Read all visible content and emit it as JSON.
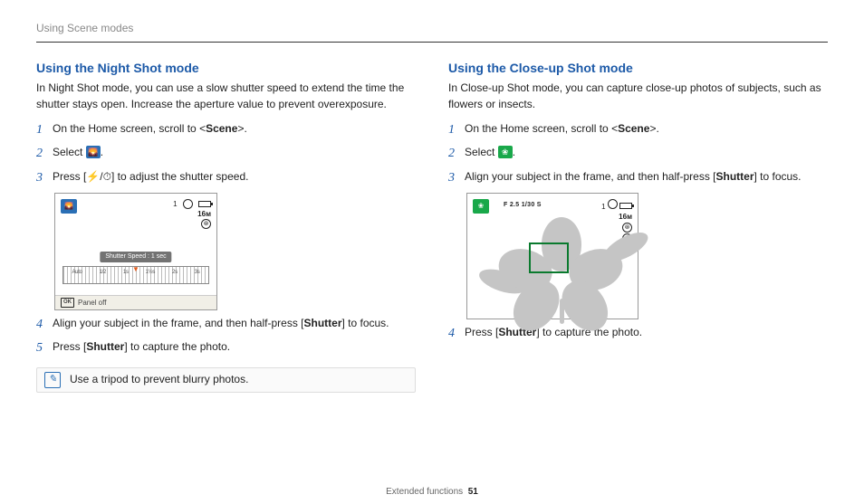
{
  "header": {
    "breadcrumb": "Using Scene modes"
  },
  "left": {
    "title": "Using the Night Shot mode",
    "intro": "In Night Shot mode, you can use a slow shutter speed to extend the time the shutter stays open. Increase the aperture value to prevent overexposure.",
    "step1_pre": "On the Home screen, scroll to <",
    "step1_bold": "Scene",
    "step1_post": ">.",
    "step2_pre": "Select ",
    "step2_post": ".",
    "step3_pre": "Press [",
    "step3_icon1": "⚡",
    "step3_sep": "/",
    "step3_icon2": "⏱",
    "step3_post": "] to adjust the shutter speed.",
    "lcd": {
      "mode_icon": "🌄",
      "count": "1",
      "res": "16ᴍ",
      "flash": "⊛",
      "ss_label": "Shutter Speed : 1 sec",
      "ticks": [
        "Auto",
        "1/2",
        "1s",
        "1½s",
        "2s",
        "3s"
      ],
      "ok": "OK",
      "panel_off": "Panel off"
    },
    "step4_pre": "Align your subject in the frame, and then half-press [",
    "step4_bold": "Shutter",
    "step4_post": "] to focus.",
    "step5_pre": "Press [",
    "step5_bold": "Shutter",
    "step5_post": "] to capture the photo.",
    "note_text": "Use a tripod to prevent blurry photos."
  },
  "right": {
    "title": "Using the Close-up Shot mode",
    "intro": "In Close-up Shot mode, you can capture close-up photos of subjects, such as flowers or insects.",
    "step1_pre": "On the Home screen, scroll to <",
    "step1_bold": "Scene",
    "step1_post": ">.",
    "step2_pre": "Select ",
    "step2_post": ".",
    "step3_pre": "Align your subject in the frame, and then half-press [",
    "step3_bold": "Shutter",
    "step3_post": "] to focus.",
    "lcd": {
      "mode_icon": "❀",
      "exposure": "F 2.5 1/30 S",
      "count": "1",
      "res": "16ᴍ",
      "flash": "⊛",
      "macro": "❀"
    },
    "step4_pre": "Press [",
    "step4_bold": "Shutter",
    "step4_post": "] to capture the photo."
  },
  "footer": {
    "section": "Extended functions",
    "page": "51"
  },
  "nums": {
    "n1": "1",
    "n2": "2",
    "n3": "3",
    "n4": "4",
    "n5": "5"
  }
}
